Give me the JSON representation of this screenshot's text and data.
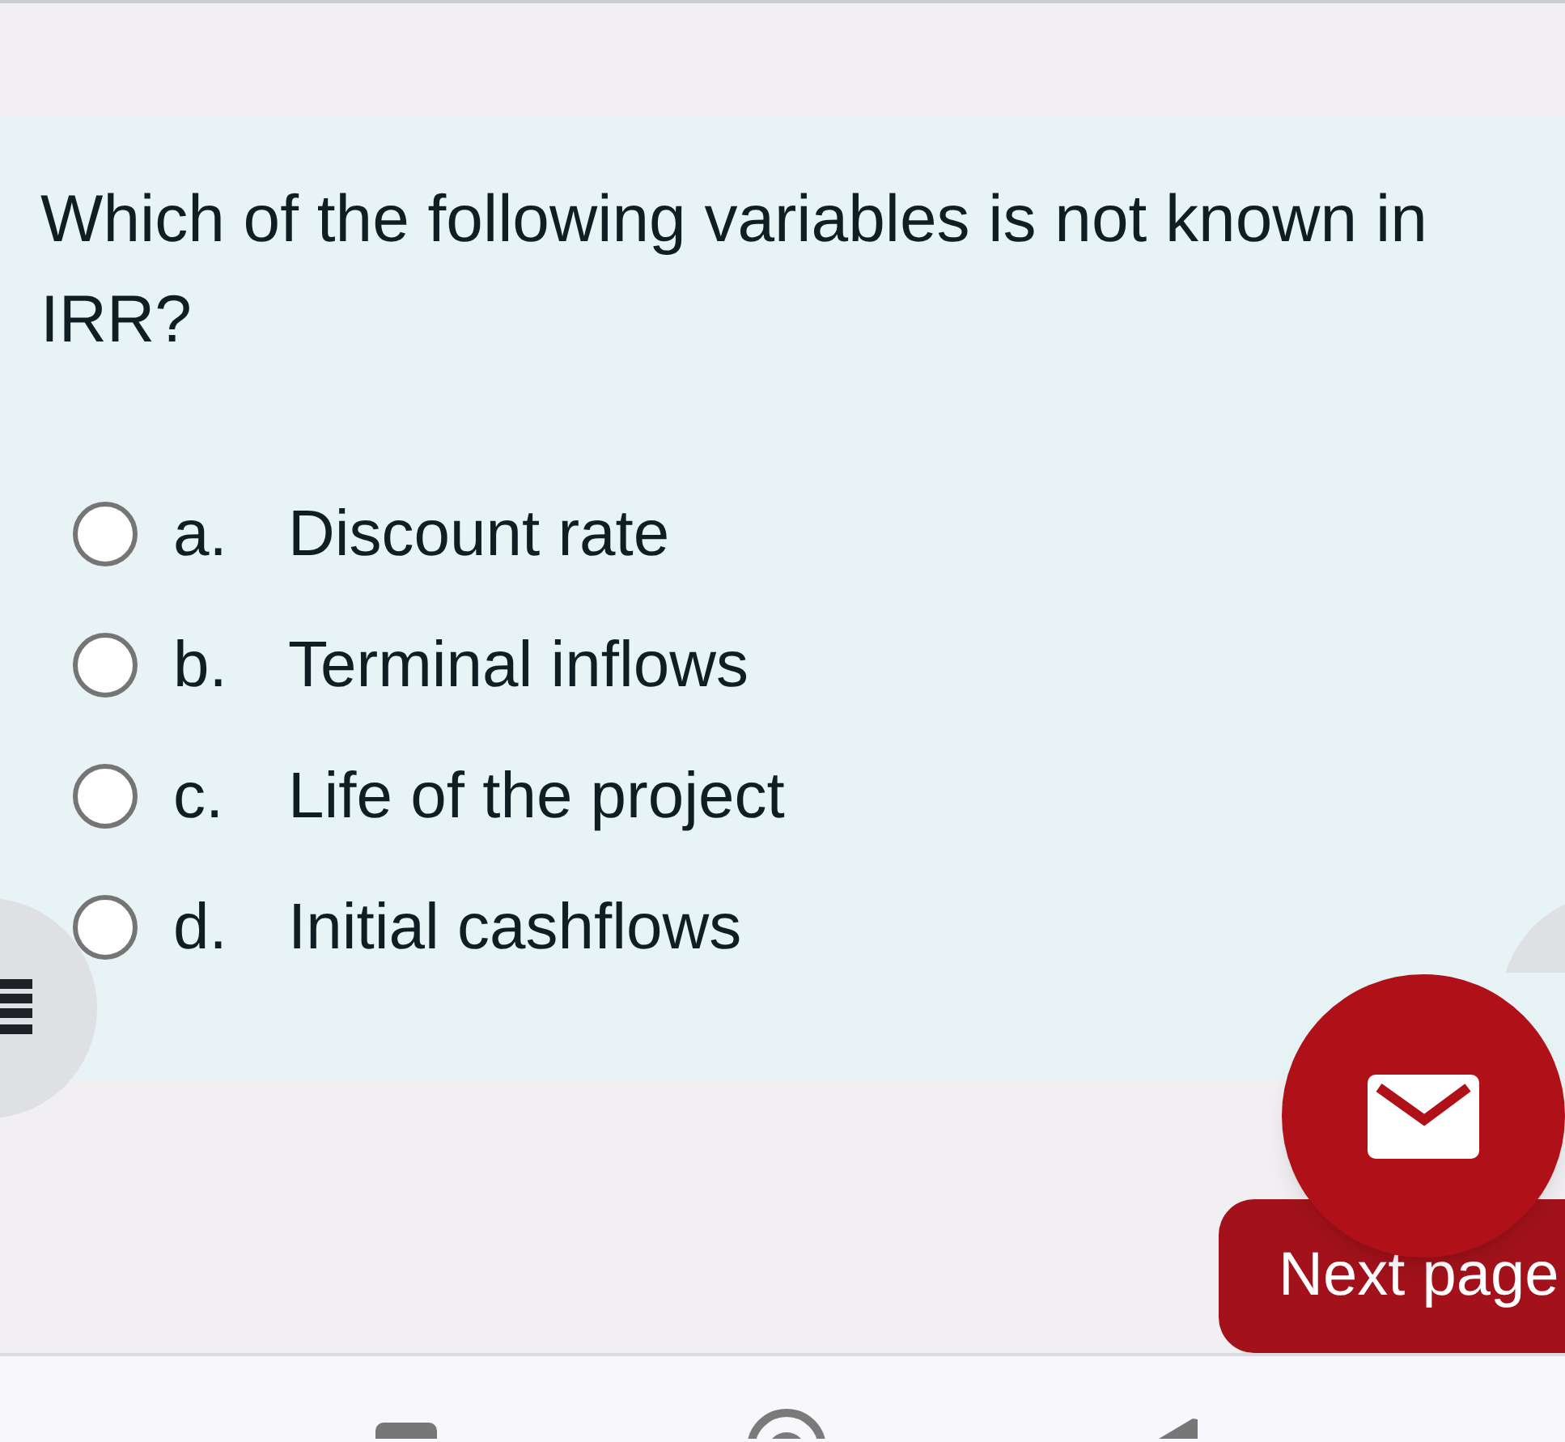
{
  "question": {
    "text": "Which of the following variables is not known in IRR?"
  },
  "options": [
    {
      "letter": "a.",
      "text": "Discount rate",
      "selected": false
    },
    {
      "letter": "b.",
      "text": "Terminal inflows",
      "selected": false
    },
    {
      "letter": "c.",
      "text": "Life of the project",
      "selected": false
    },
    {
      "letter": "d.",
      "text": "Initial cashflows",
      "selected": false
    }
  ],
  "next_button": {
    "label": "Next page"
  }
}
